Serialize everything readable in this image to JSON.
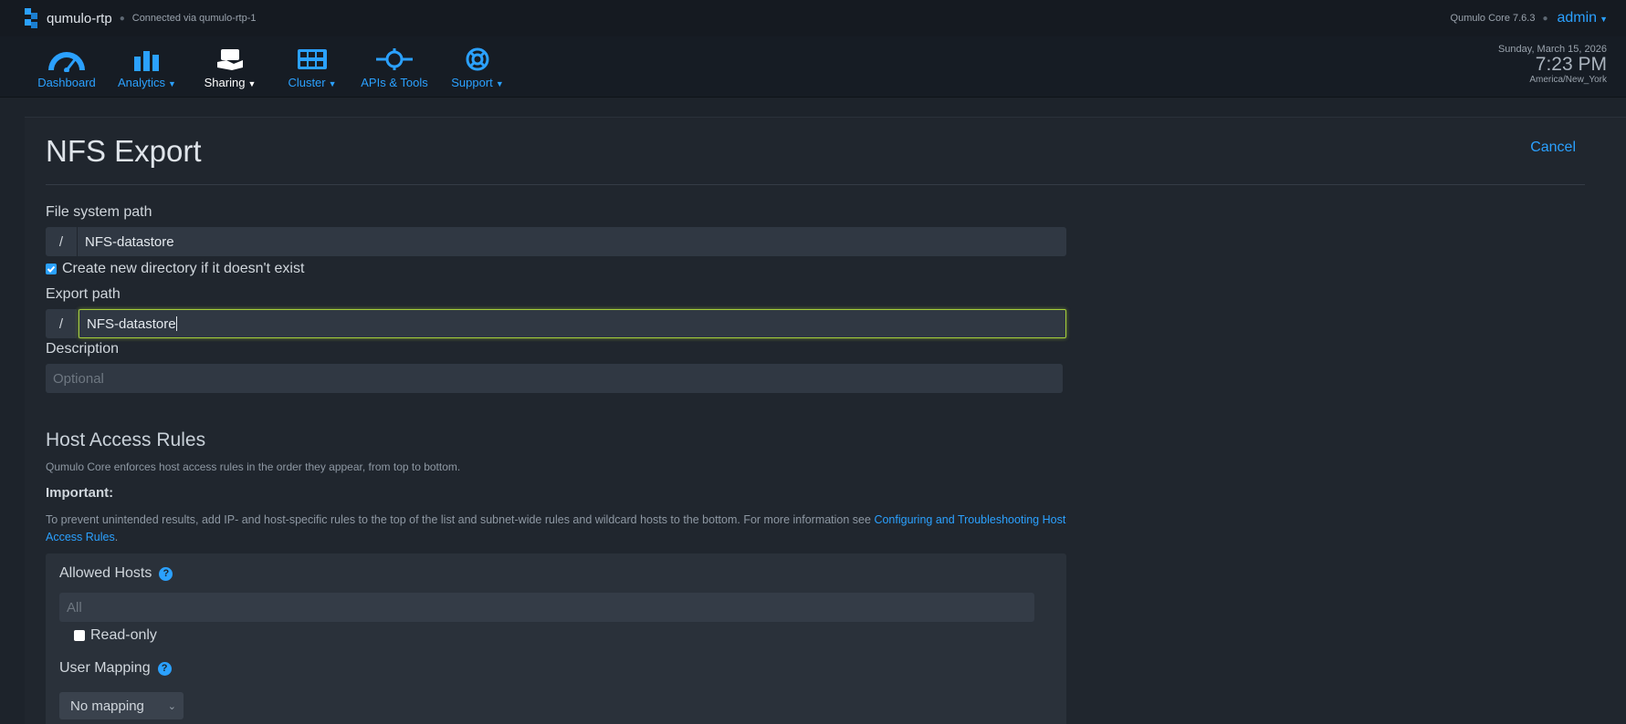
{
  "topbar": {
    "cluster_name": "qumulo-rtp",
    "connection": "Connected via qumulo-rtp-1",
    "version": "Qumulo Core 7.6.3",
    "user": "admin"
  },
  "nav": {
    "items": [
      {
        "label": "Dashboard",
        "icon": "gauge-icon"
      },
      {
        "label": "Analytics",
        "icon": "bar-chart-icon"
      },
      {
        "label": "Sharing",
        "icon": "sharing-icon"
      },
      {
        "label": "Cluster",
        "icon": "server-icon"
      },
      {
        "label": "APIs & Tools",
        "icon": "api-icon"
      },
      {
        "label": "Support",
        "icon": "lifebuoy-icon"
      }
    ]
  },
  "clock": {
    "date": "Sunday, March 15, 2026",
    "time": "7:23 PM",
    "timezone": "America/New_York"
  },
  "form": {
    "title": "NFS Export",
    "cancel_label": "Cancel",
    "fs_path_label": "File system path",
    "fs_path_prefix": "/",
    "fs_path_value": "NFS-datastore",
    "create_dir_label": "Create new directory if it doesn't exist",
    "create_dir_checked": true,
    "export_path_label": "Export path",
    "export_path_prefix": "/",
    "export_path_value": "NFS-datastore",
    "description_label": "Description",
    "description_placeholder": "Optional"
  },
  "host_access": {
    "title": "Host Access Rules",
    "intro": "Qumulo Core enforces host access rules in the order they appear, from top to bottom.",
    "important_label": "Important:",
    "note_text": "To prevent unintended results, add IP- and host-specific rules to the top of the list and subnet-wide rules and wildcard hosts to the bottom. For more information see ",
    "note_link": "Configuring and Troubleshooting Host Access Rules",
    "note_end": ".",
    "allowed_hosts_label": "Allowed Hosts",
    "allowed_hosts_placeholder": "All",
    "readonly_label": "Read-only",
    "readonly_checked": false,
    "user_mapping_label": "User Mapping",
    "user_mapping_value": "No mapping"
  },
  "colors": {
    "accent": "#2ba1ff",
    "focus": "#a5ce3a",
    "background": "#1d232b"
  }
}
